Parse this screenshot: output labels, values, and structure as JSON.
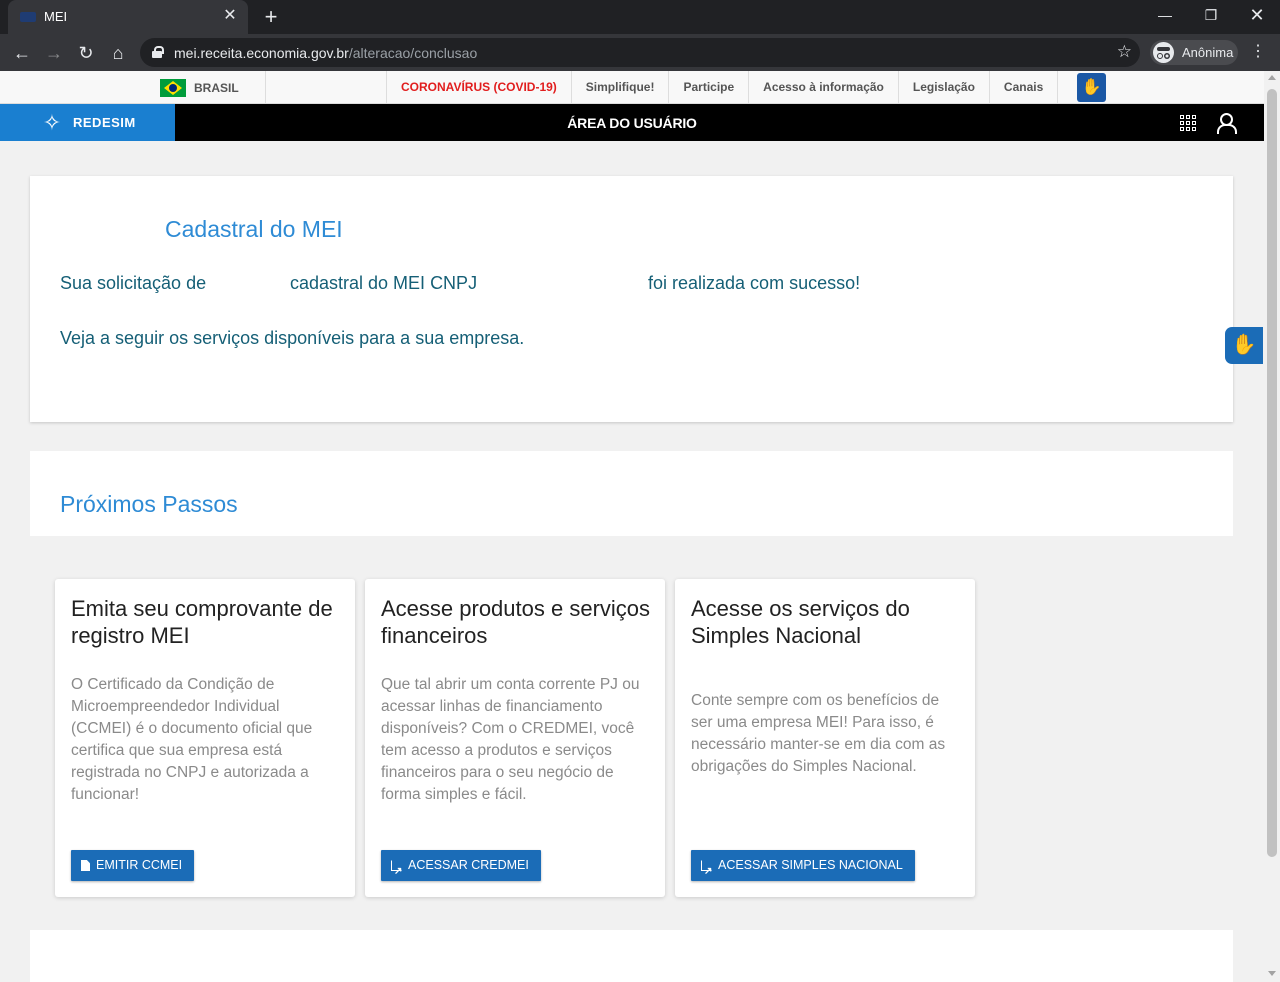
{
  "browser": {
    "tab_title": "MEI",
    "tab_close": "✕",
    "new_tab": "+",
    "url_host": "mei.receita.economia.gov.br",
    "url_path": "/alteracao/conclusao",
    "profile_label": "Anônima",
    "win_min": "—",
    "win_max": "❐",
    "win_close": "✕"
  },
  "govbar": {
    "country": "BRASIL",
    "links": [
      "CORONAVÍRUS (COVID-19)",
      "Simplifique!",
      "Participe",
      "Acesso à informação",
      "Legislação",
      "Canais"
    ]
  },
  "header": {
    "logo_text": "REDESIM",
    "title": "ÁREA DO USUÁRIO"
  },
  "confirmation": {
    "title": "Cadastral do MEI",
    "line_part1": "Sua solicitação de",
    "line_part2": "cadastral do MEI CNPJ",
    "line_part3": "foi realizada com sucesso!",
    "line2": "Veja a seguir os serviços disponíveis para a sua empresa."
  },
  "next_steps": {
    "title": "Próximos Passos",
    "cards": [
      {
        "title": "Emita seu comprovante de registro MEI",
        "body": "O Certificado da Condição de Microempreendedor Individual (CCMEI) é o documento oficial que certifica que sua empresa está registrada no CNPJ e autorizada a funcionar!",
        "button": "EMITIR CCMEI"
      },
      {
        "title": "Acesse produtos e serviços financeiros",
        "body": "Que tal abrir um conta corrente PJ ou acessar linhas de financiamento disponíveis? Com o CREDMEI, você tem acesso a produtos e serviços financeiros para o seu negócio de forma simples e fácil.",
        "button": "ACESSAR CREDMEI"
      },
      {
        "title": "Acesse os serviços do Simples Nacional",
        "body": "Conte sempre com os benefícios de ser uma empresa MEI! Para isso, é necessário manter-se em dia com as obrigações do Simples Nacional.",
        "button": "ACESSAR SIMPLES NACIONAL"
      }
    ]
  },
  "colors": {
    "accent_blue": "#2e8bd5",
    "text_teal": "#155f76",
    "button_blue": "#1b6cb7",
    "covid_red": "#e11d1d",
    "logo_blue": "#1a7fd0"
  },
  "icons": {
    "back": "arrow-left-icon",
    "forward": "arrow-right-icon",
    "reload": "reload-icon",
    "home": "home-icon",
    "star": "star-icon",
    "apps": "apps-grid-icon",
    "user": "user-icon",
    "vlibras": "hands-sign-language-icon"
  }
}
